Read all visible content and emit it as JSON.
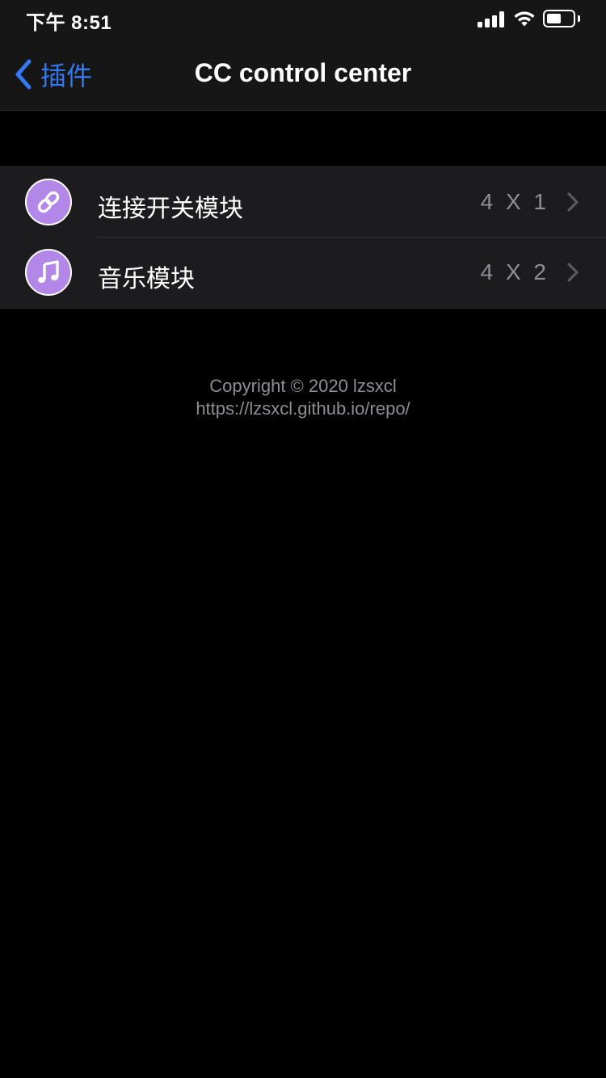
{
  "status_bar": {
    "time": "下午 8:51",
    "signal_icon": "signal-bars-icon",
    "wifi_icon": "wifi-icon",
    "battery_icon": "battery-icon",
    "battery_level": 0.5
  },
  "nav": {
    "back_label": "插件",
    "back_icon": "chevron-left-icon",
    "title": "CC control center"
  },
  "colors": {
    "accent": "#3478f6",
    "icon_bg": "#b387e8",
    "secondary_text": "#8e8e93",
    "cell_bg": "#1c1c1e",
    "nav_bg": "#161616"
  },
  "modules": [
    {
      "label": "连接开关模块",
      "detail": "4 X 1",
      "icon": "link-icon"
    },
    {
      "label": "音乐模块",
      "detail": "4 X 2",
      "icon": "music-note-icon"
    }
  ],
  "footer": {
    "copyright": "Copyright © 2020 lzsxcl",
    "url": "https://lzsxcl.github.io/repo/"
  }
}
